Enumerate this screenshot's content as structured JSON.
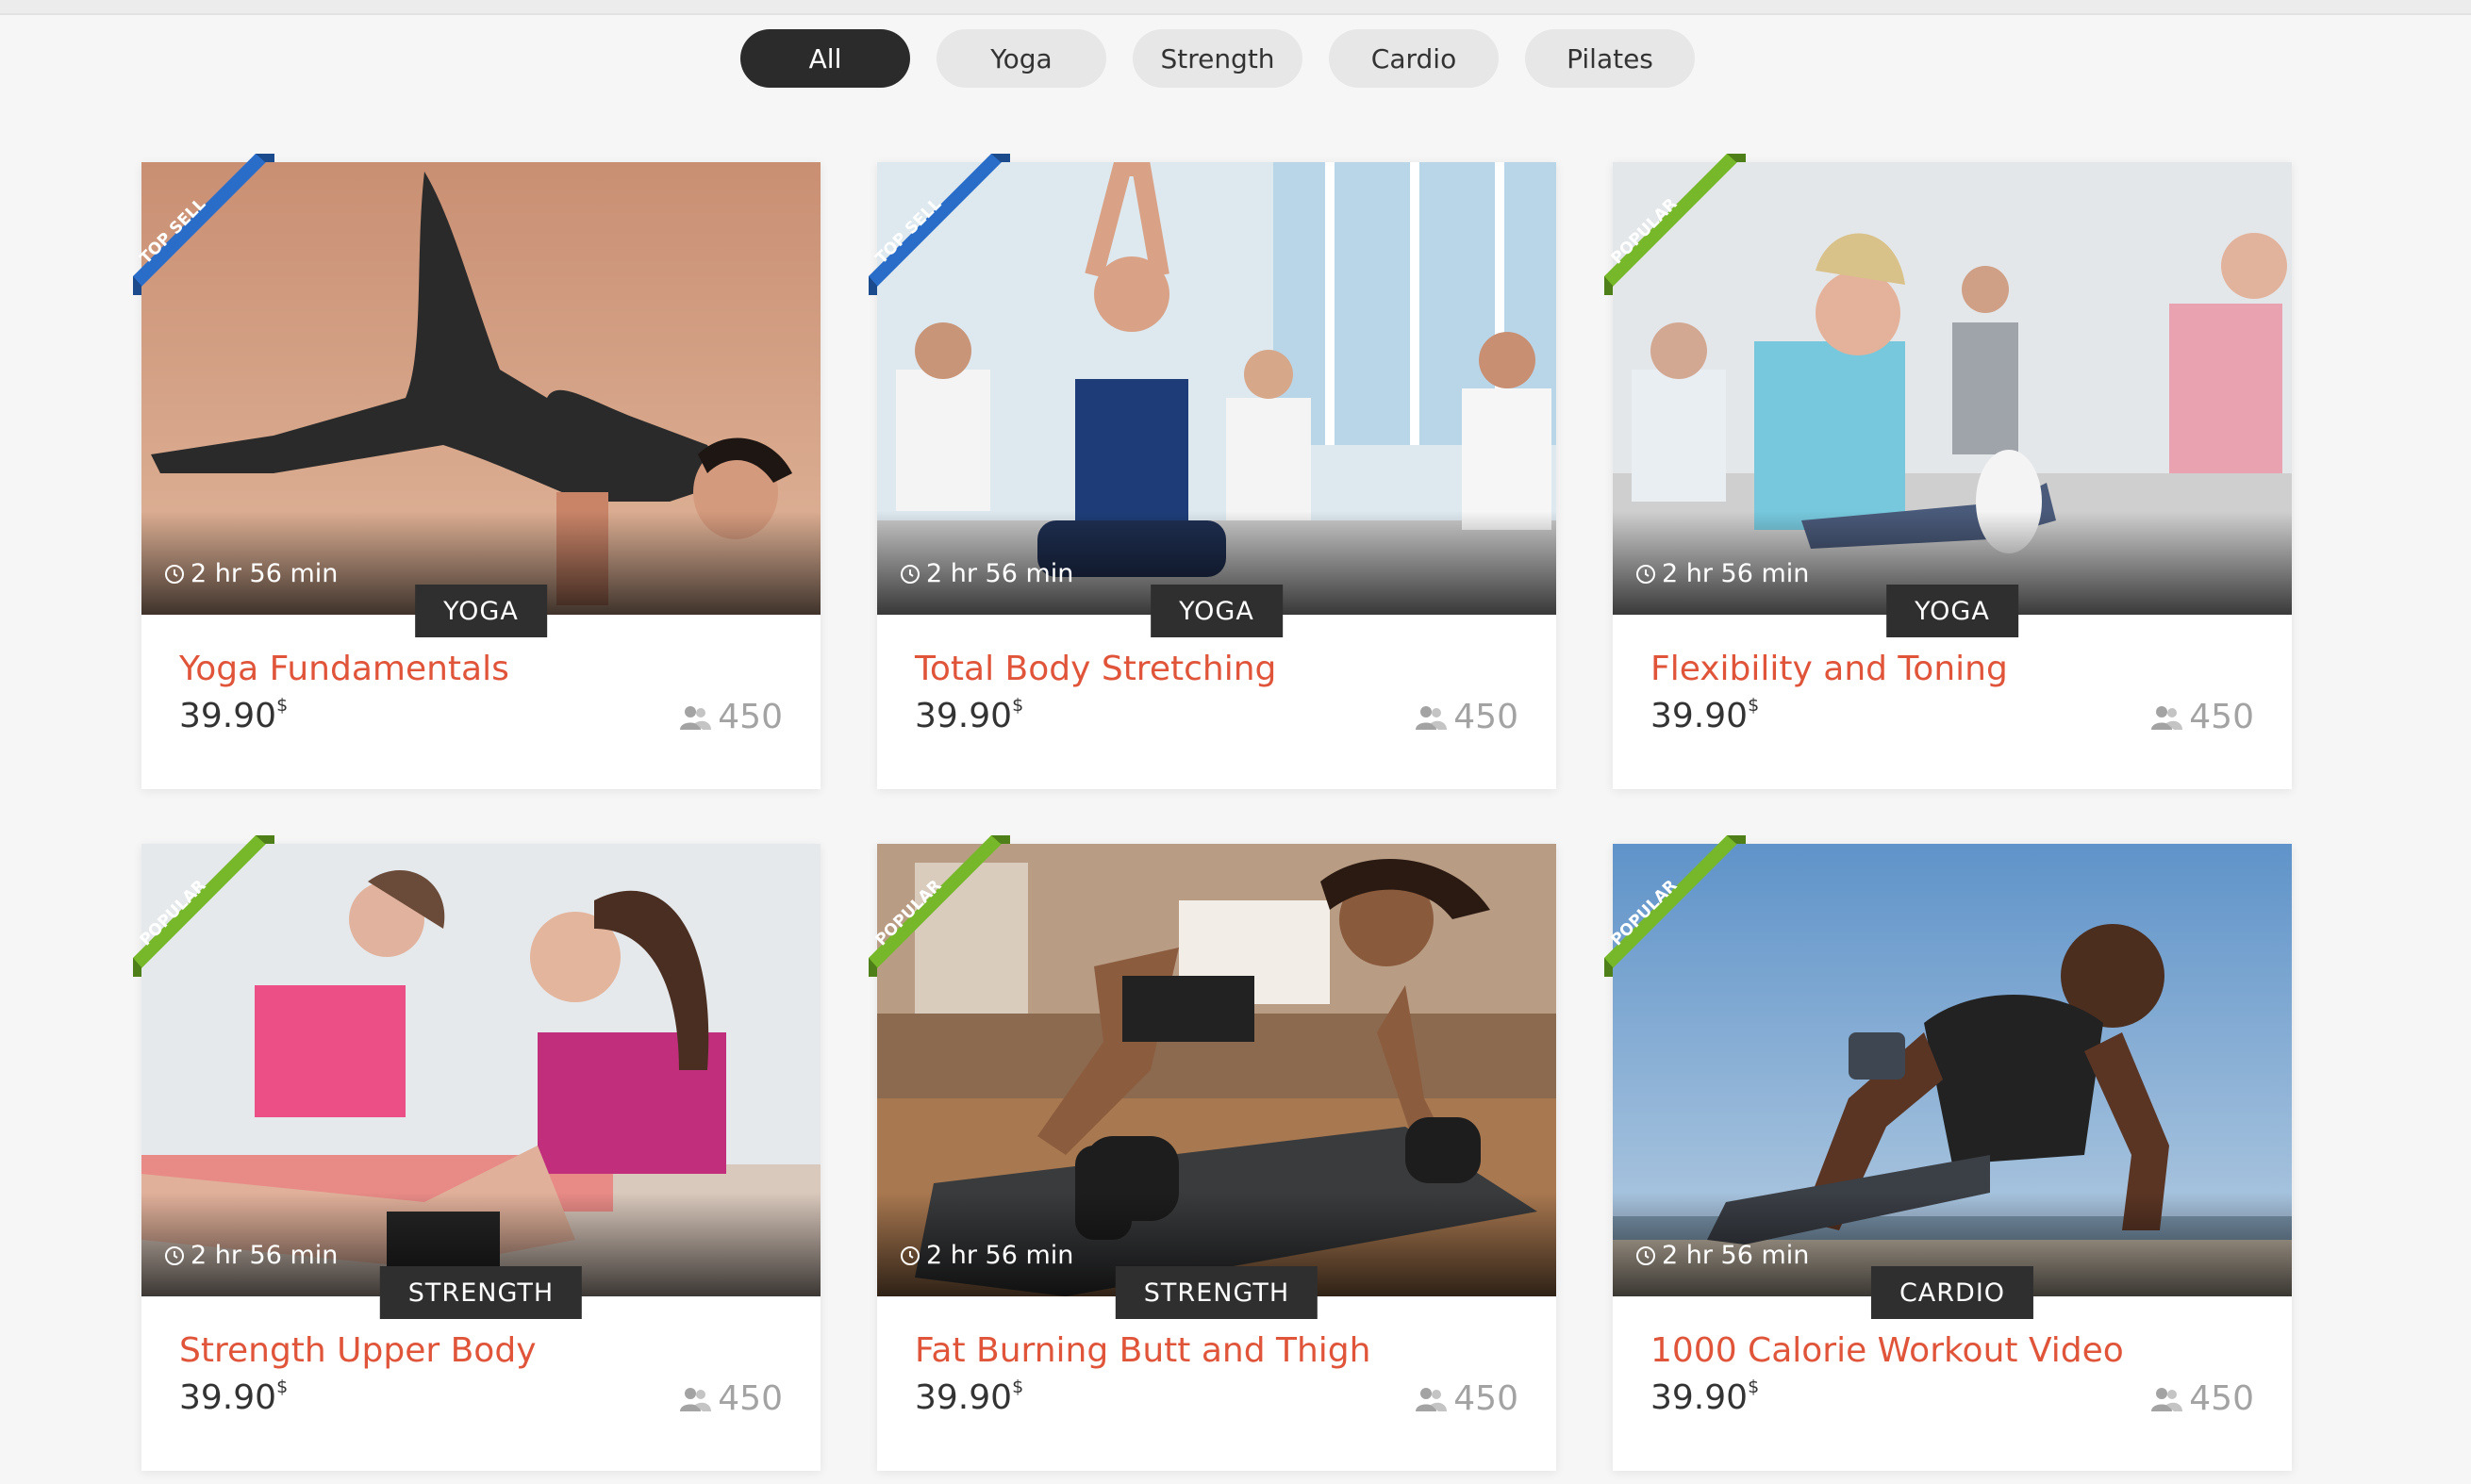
{
  "filters": {
    "items": [
      "All",
      "Yoga",
      "Strength",
      "Cardio",
      "Pilates"
    ],
    "active": "All"
  },
  "courses": [
    {
      "ribbon": "TOP SELL",
      "ribbon_color": "#2a6dc9",
      "duration": "2 hr 56 min",
      "category": "YOGA",
      "title": "Yoga Fundamentals",
      "price": "39.90",
      "currency": "$",
      "students": "450"
    },
    {
      "ribbon": "TOP SELL",
      "ribbon_color": "#2a6dc9",
      "duration": "2 hr 56 min",
      "category": "YOGA",
      "title": "Total Body Stretching",
      "price": "39.90",
      "currency": "$",
      "students": "450"
    },
    {
      "ribbon": "POPULAR",
      "ribbon_color": "#76b82a",
      "duration": "2 hr 56 min",
      "category": "YOGA",
      "title": "Flexibility and Toning",
      "price": "39.90",
      "currency": "$",
      "students": "450"
    },
    {
      "ribbon": "POPULAR",
      "ribbon_color": "#76b82a",
      "duration": "2 hr 56 min",
      "category": "STRENGTH",
      "title": "Strength Upper Body",
      "price": "39.90",
      "currency": "$",
      "students": "450"
    },
    {
      "ribbon": "POPULAR",
      "ribbon_color": "#76b82a",
      "duration": "2 hr 56 min",
      "category": "STRENGTH",
      "title": "Fat Burning Butt and Thigh",
      "price": "39.90",
      "currency": "$",
      "students": "450"
    },
    {
      "ribbon": "POPULAR",
      "ribbon_color": "#76b82a",
      "duration": "2 hr 56 min",
      "category": "CARDIO",
      "title": "1000 Calorie Workout Video",
      "price": "39.90",
      "currency": "$",
      "students": "450"
    }
  ],
  "colors": {
    "accent": "#e0543a",
    "dark": "#2b2b2b",
    "blue_ribbon": "#2a6dc9",
    "green_ribbon": "#76b82a"
  },
  "icons": {
    "duration": "clock-icon",
    "students": "users-icon"
  }
}
